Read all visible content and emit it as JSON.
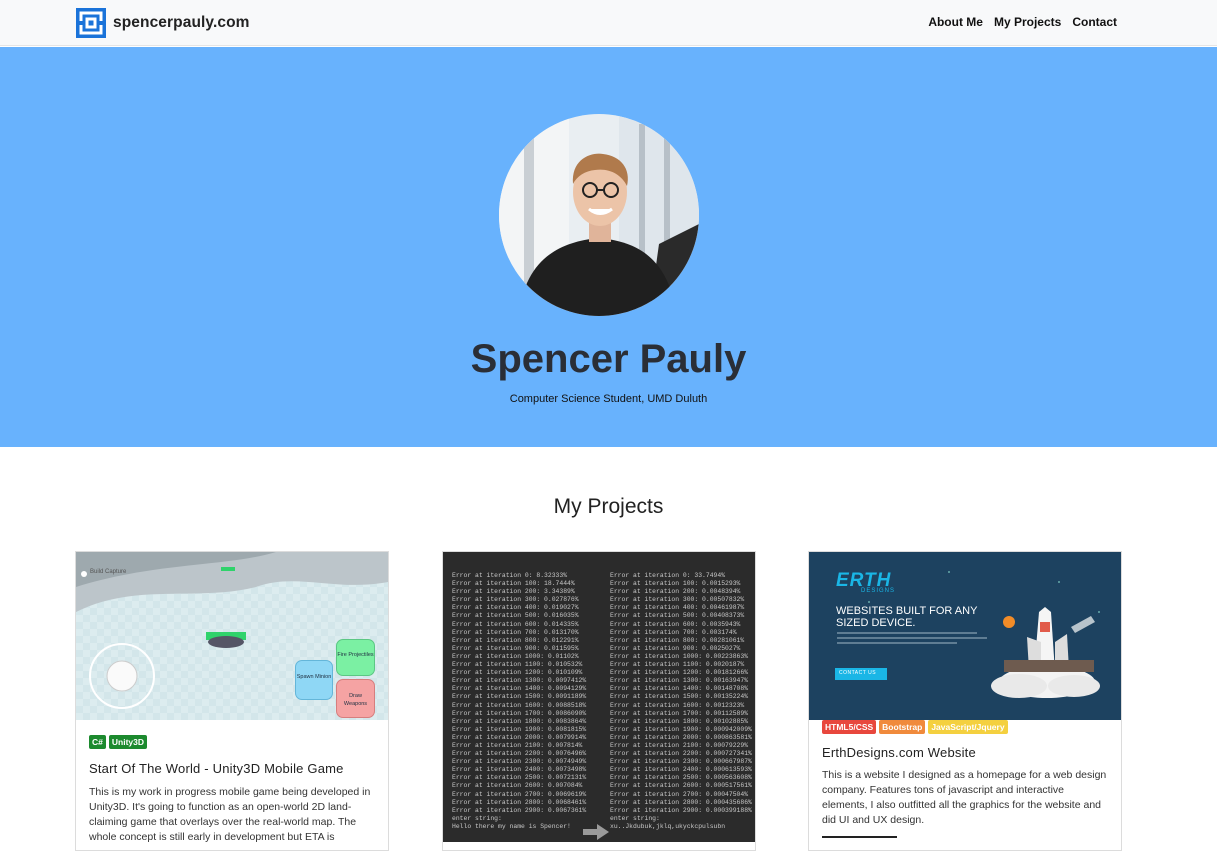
{
  "nav": {
    "brand": "spencerpauly.com",
    "links": [
      "About Me",
      "My Projects",
      "Contact"
    ]
  },
  "hero": {
    "name": "Spencer Pauly",
    "subtitle": "Computer Science Student, UMD Duluth"
  },
  "projects": {
    "title": "My Projects",
    "cards": [
      {
        "badges": [
          {
            "label": "C#",
            "color": "#1c8a2e"
          },
          {
            "label": "Unity3D",
            "color": "#1c8a2e"
          }
        ],
        "title": "Start Of The World - Unity3D Mobile Game",
        "text": "This is my work in progress mobile game being developed in Unity3D. It's going to function as an open-world 2D land-claiming game that overlays over the real-world map. The whole concept is still early in development but ETA is",
        "image": {
          "label": "Build Capture",
          "buttons": [
            "Fire Projectiles",
            "Spawn Minion",
            "Draw Weapons"
          ]
        }
      },
      {
        "badges": [],
        "title": "",
        "text": "",
        "image": {
          "left_lines": [
            "Error at iteration 0: 8.32333%",
            "Error at iteration 100: 18.7444%",
            "Error at iteration 200: 3.34389%",
            "Error at iteration 300: 0.027876%",
            "Error at iteration 400: 0.019027%",
            "Error at iteration 500: 0.016035%",
            "Error at iteration 600: 0.014335%",
            "Error at iteration 700: 0.013170%",
            "Error at iteration 800: 0.012291%",
            "Error at iteration 900: 0.011595%",
            "Error at iteration 1000: 0.01102%",
            "Error at iteration 1100: 0.010532%",
            "Error at iteration 1200: 0.010109%",
            "Error at iteration 1300: 0.0097412%",
            "Error at iteration 1400: 0.0094129%",
            "Error at iteration 1500: 0.0091189%",
            "Error at iteration 1600: 0.0088518%",
            "Error at iteration 1700: 0.0086090%",
            "Error at iteration 1800: 0.0083864%",
            "Error at iteration 1900: 0.0081815%",
            "Error at iteration 2000: 0.0079914%",
            "Error at iteration 2100: 0.007814%",
            "Error at iteration 2200: 0.0076496%",
            "Error at iteration 2300: 0.0074949%",
            "Error at iteration 2400: 0.0073498%",
            "Error at iteration 2500: 0.0072131%",
            "Error at iteration 2600: 0.007084%",
            "Error at iteration 2700: 0.0069619%",
            "Error at iteration 2800: 0.0068461%",
            "Error at iteration 2900: 0.0067361%",
            "enter string:",
            "Hello there my name is Spencer!"
          ],
          "right_lines": [
            "Error at iteration 0: 33.7494%",
            "Error at iteration 100: 0.0015293%",
            "Error at iteration 200: 0.0048394%",
            "Error at iteration 300: 0.00507832%",
            "Error at iteration 400: 0.00461987%",
            "Error at iteration 500: 0.00408373%",
            "Error at iteration 600: 0.0035943%",
            "Error at iteration 700: 0.003174%",
            "Error at iteration 800: 0.00281061%",
            "Error at iteration 900: 0.0025027%",
            "Error at iteration 1000: 0.00223863%",
            "Error at iteration 1100: 0.0020187%",
            "Error at iteration 1200: 0.00181266%",
            "Error at iteration 1300: 0.00163947%",
            "Error at iteration 1400: 0.00148708%",
            "Error at iteration 1500: 0.00135224%",
            "Error at iteration 1600: 0.0012323%",
            "Error at iteration 1700: 0.00112589%",
            "Error at iteration 1800: 0.00102885%",
            "Error at iteration 1900: 0.000942009%",
            "Error at iteration 2000: 0.000863581%",
            "Error at iteration 2100: 0.00079229%",
            "Error at iteration 2200: 0.000727341%",
            "Error at iteration 2300: 0.000667987%",
            "Error at iteration 2400: 0.000613593%",
            "Error at iteration 2500: 0.000563608%",
            "Error at iteration 2600: 0.000517561%",
            "Error at iteration 2700: 0.00047504%",
            "Error at iteration 2800: 0.000435686%",
            "Error at iteration 2900: 0.000399188%",
            "enter string:",
            "xu..Jkdubuk,jklq,ukyckcpulsubn"
          ]
        }
      },
      {
        "badges": [
          {
            "label": "HTML5/CSS",
            "color": "#e8473d"
          },
          {
            "label": "Bootstrap",
            "color": "#f08a3c"
          },
          {
            "label": "JavaScript/Jquery",
            "color": "#f4d03f"
          }
        ],
        "title": "ErthDesigns.com Website",
        "text": "This is a website I designed as a homepage for a web design company. Features tons of javascript and interactive elements, I also outfitted all the graphics for the website and did UI and UX design.",
        "image": {
          "logo": "ERTH",
          "logo_sub": "DESIGNS",
          "headline": "WEBSITES BUILT FOR ANY SIZED DEVICE.",
          "cta": "CONTACT US"
        }
      }
    ]
  }
}
